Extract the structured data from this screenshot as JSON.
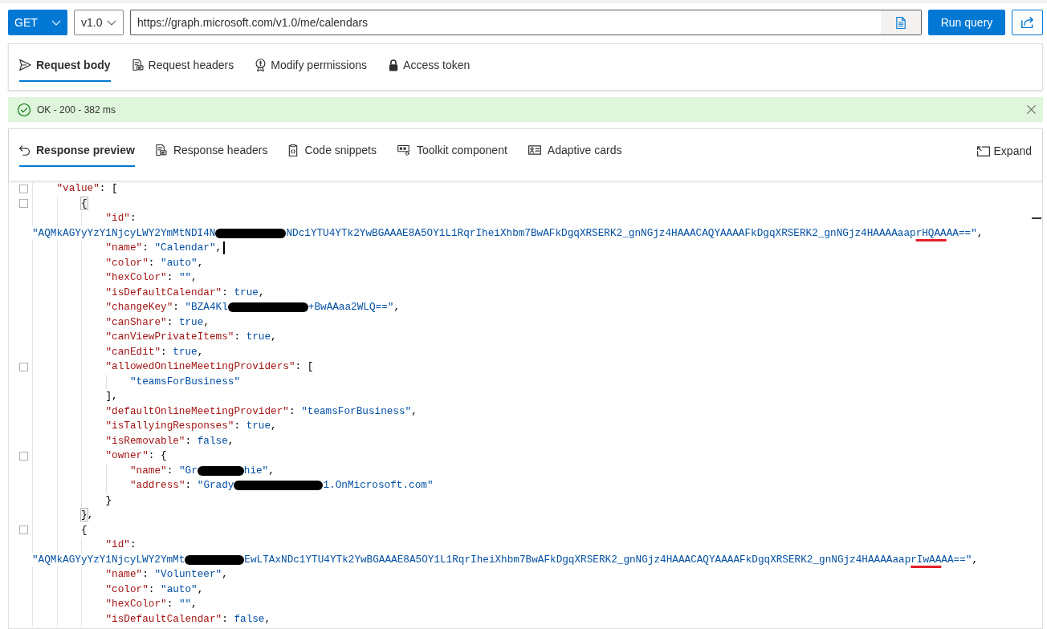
{
  "request_bar": {
    "method": "GET",
    "version": "v1.0",
    "url": "https://graph.microsoft.com/v1.0/me/calendars",
    "run_button": "Run query"
  },
  "request_tabs": [
    {
      "label": "Request body",
      "selected": true
    },
    {
      "label": "Request headers",
      "selected": false
    },
    {
      "label": "Modify permissions",
      "selected": false
    },
    {
      "label": "Access token",
      "selected": false
    }
  ],
  "status_bar": {
    "kind": "success",
    "text": "OK - 200 - 382 ms"
  },
  "response_tabs": [
    {
      "label": "Response preview",
      "selected": true
    },
    {
      "label": "Response headers",
      "selected": false
    },
    {
      "label": "Code snippets",
      "selected": false
    },
    {
      "label": "Toolkit component",
      "selected": false
    },
    {
      "label": "Adaptive cards",
      "selected": false
    }
  ],
  "expand_button": "Expand",
  "editor": {
    "lines": [
      {
        "segments": [
          {
            "kind": "key",
            "text": "\"value\""
          },
          {
            "kind": "punct",
            "text": ": ["
          }
        ],
        "children": [
          {
            "segments": [
              {
                "kind": "match",
                "text": "{"
              }
            ],
            "children": [
              {
                "segments": [
                  {
                    "kind": "key",
                    "text": "\"id\""
                  },
                  {
                    "kind": "punct",
                    "text": ":"
                  }
                ],
                "wrap": [
                  {
                    "kind": "str",
                    "text": "\"AQMkAGYyYzY1NjcyLWY2YmMtNDI4N"
                  },
                  {
                    "kind": "redaction"
                  },
                  {
                    "kind": "str",
                    "text": "NDc1YTU4YTk2YwBGAAAE8A5OY1L1RqrIheiXhbm7BwAFkDgqXRSERK2_gnNGjz4HAAACAQYAAAAFkDgqXRSERK2_gnNGjz4HAAAAaap"
                  },
                  {
                    "kind": "marked",
                    "text": "rHQAA"
                  },
                  {
                    "kind": "str",
                    "text": "AA==\""
                  },
                  {
                    "kind": "punct",
                    "text": ","
                  }
                ]
              },
              {
                "segments": [
                  {
                    "kind": "key",
                    "text": "\"name\""
                  },
                  {
                    "kind": "punct",
                    "text": ": "
                  },
                  {
                    "kind": "str",
                    "text": "\"Calendar\""
                  },
                  {
                    "kind": "punct",
                    "text": ","
                  },
                  {
                    "kind": "caret"
                  }
                ]
              },
              {
                "segments": [
                  {
                    "kind": "key",
                    "text": "\"color\""
                  },
                  {
                    "kind": "punct",
                    "text": ": "
                  },
                  {
                    "kind": "str",
                    "text": "\"auto\""
                  },
                  {
                    "kind": "punct",
                    "text": ","
                  }
                ]
              },
              {
                "segments": [
                  {
                    "kind": "key",
                    "text": "\"hexColor\""
                  },
                  {
                    "kind": "punct",
                    "text": ": "
                  },
                  {
                    "kind": "str",
                    "text": "\"\""
                  },
                  {
                    "kind": "punct",
                    "text": ","
                  }
                ]
              },
              {
                "segments": [
                  {
                    "kind": "key",
                    "text": "\"isDefaultCalendar\""
                  },
                  {
                    "kind": "punct",
                    "text": ": "
                  },
                  {
                    "kind": "lit",
                    "text": "true"
                  },
                  {
                    "kind": "punct",
                    "text": ","
                  }
                ]
              },
              {
                "segments": [
                  {
                    "kind": "key",
                    "text": "\"changeKey\""
                  },
                  {
                    "kind": "punct",
                    "text": ": "
                  },
                  {
                    "kind": "str",
                    "text": "\"BZA4Kl"
                  },
                  {
                    "kind": "redaction"
                  },
                  {
                    "kind": "str",
                    "text": "+BwAAaa2WLQ==\""
                  },
                  {
                    "kind": "punct",
                    "text": ","
                  }
                ]
              },
              {
                "segments": [
                  {
                    "kind": "key",
                    "text": "\"canShare\""
                  },
                  {
                    "kind": "punct",
                    "text": ": "
                  },
                  {
                    "kind": "lit",
                    "text": "true"
                  },
                  {
                    "kind": "punct",
                    "text": ","
                  }
                ]
              },
              {
                "segments": [
                  {
                    "kind": "key",
                    "text": "\"canViewPrivateItems\""
                  },
                  {
                    "kind": "punct",
                    "text": ": "
                  },
                  {
                    "kind": "lit",
                    "text": "true"
                  },
                  {
                    "kind": "punct",
                    "text": ","
                  }
                ]
              },
              {
                "segments": [
                  {
                    "kind": "key",
                    "text": "\"canEdit\""
                  },
                  {
                    "kind": "punct",
                    "text": ": "
                  },
                  {
                    "kind": "lit",
                    "text": "true"
                  },
                  {
                    "kind": "punct",
                    "text": ","
                  }
                ]
              },
              {
                "segments": [
                  {
                    "kind": "key",
                    "text": "\"allowedOnlineMeetingProviders\""
                  },
                  {
                    "kind": "punct",
                    "text": ": ["
                  }
                ],
                "children": [
                  {
                    "segments": [
                      {
                        "kind": "str",
                        "text": "\"teamsForBusiness\""
                      }
                    ]
                  }
                ]
              },
              {
                "segments": [
                  {
                    "kind": "punct",
                    "text": "],"
                  }
                ]
              },
              {
                "segments": [
                  {
                    "kind": "key",
                    "text": "\"defaultOnlineMeetingProvider\""
                  },
                  {
                    "kind": "punct",
                    "text": ": "
                  },
                  {
                    "kind": "str",
                    "text": "\"teamsForBusiness\""
                  },
                  {
                    "kind": "punct",
                    "text": ","
                  }
                ]
              },
              {
                "segments": [
                  {
                    "kind": "key",
                    "text": "\"isTallyingResponses\""
                  },
                  {
                    "kind": "punct",
                    "text": ": "
                  },
                  {
                    "kind": "lit",
                    "text": "true"
                  },
                  {
                    "kind": "punct",
                    "text": ","
                  }
                ]
              },
              {
                "segments": [
                  {
                    "kind": "key",
                    "text": "\"isRemovable\""
                  },
                  {
                    "kind": "punct",
                    "text": ": "
                  },
                  {
                    "kind": "lit",
                    "text": "false"
                  },
                  {
                    "kind": "punct",
                    "text": ","
                  }
                ]
              },
              {
                "segments": [
                  {
                    "kind": "key",
                    "text": "\"owner\""
                  },
                  {
                    "kind": "punct",
                    "text": ": {"
                  }
                ],
                "children": [
                  {
                    "segments": [
                      {
                        "kind": "key",
                        "text": "\"name\""
                      },
                      {
                        "kind": "punct",
                        "text": ": "
                      },
                      {
                        "kind": "str",
                        "text": "\"Gr"
                      },
                      {
                        "kind": "redaction"
                      },
                      {
                        "kind": "str",
                        "text": "hie\""
                      },
                      {
                        "kind": "punct",
                        "text": ","
                      }
                    ]
                  },
                  {
                    "segments": [
                      {
                        "kind": "key",
                        "text": "\"address\""
                      },
                      {
                        "kind": "punct",
                        "text": ": "
                      },
                      {
                        "kind": "str",
                        "text": "\"Grady"
                      },
                      {
                        "kind": "redaction"
                      },
                      {
                        "kind": "str",
                        "text": "1.OnMicrosoft.com\""
                      }
                    ]
                  }
                ]
              },
              {
                "segments": [
                  {
                    "kind": "punct",
                    "text": "}"
                  }
                ]
              }
            ]
          },
          {
            "segments": [
              {
                "kind": "match",
                "text": "}"
              },
              {
                "kind": "punct",
                "text": ","
              }
            ]
          },
          {
            "segments": [
              {
                "kind": "punct",
                "text": "{"
              }
            ],
            "children": [
              {
                "segments": [
                  {
                    "kind": "key",
                    "text": "\"id\""
                  },
                  {
                    "kind": "punct",
                    "text": ":"
                  }
                ],
                "wrap": [
                  {
                    "kind": "str",
                    "text": "\"AQMkAGYyYzY1NjcyLWY2YmMt"
                  },
                  {
                    "kind": "redaction"
                  },
                  {
                    "kind": "str",
                    "text": "EwLTAxNDc1YTU4YTk2YwBGAAAE8A5OY1L1RqrIheiXhbm7BwAFkDgqXRSERK2_gnNGjz4HAAACAQYAAAAFkDgqXRSERK2_gnNGjz4HAAAAaap"
                  },
                  {
                    "kind": "marked",
                    "text": "rIwAA"
                  },
                  {
                    "kind": "str",
                    "text": "AA==\""
                  },
                  {
                    "kind": "punct",
                    "text": ","
                  }
                ]
              },
              {
                "segments": [
                  {
                    "kind": "key",
                    "text": "\"name\""
                  },
                  {
                    "kind": "punct",
                    "text": ": "
                  },
                  {
                    "kind": "str",
                    "text": "\"Volunteer\""
                  },
                  {
                    "kind": "punct",
                    "text": ","
                  }
                ]
              },
              {
                "segments": [
                  {
                    "kind": "key",
                    "text": "\"color\""
                  },
                  {
                    "kind": "punct",
                    "text": ": "
                  },
                  {
                    "kind": "str",
                    "text": "\"auto\""
                  },
                  {
                    "kind": "punct",
                    "text": ","
                  }
                ]
              },
              {
                "segments": [
                  {
                    "kind": "key",
                    "text": "\"hexColor\""
                  },
                  {
                    "kind": "punct",
                    "text": ": "
                  },
                  {
                    "kind": "str",
                    "text": "\"\""
                  },
                  {
                    "kind": "punct",
                    "text": ","
                  }
                ]
              },
              {
                "segments": [
                  {
                    "kind": "key",
                    "text": "\"isDefaultCalendar\""
                  },
                  {
                    "kind": "punct",
                    "text": ": "
                  },
                  {
                    "kind": "lit",
                    "text": "false"
                  },
                  {
                    "kind": "punct",
                    "text": ","
                  }
                ]
              }
            ]
          }
        ]
      }
    ]
  }
}
